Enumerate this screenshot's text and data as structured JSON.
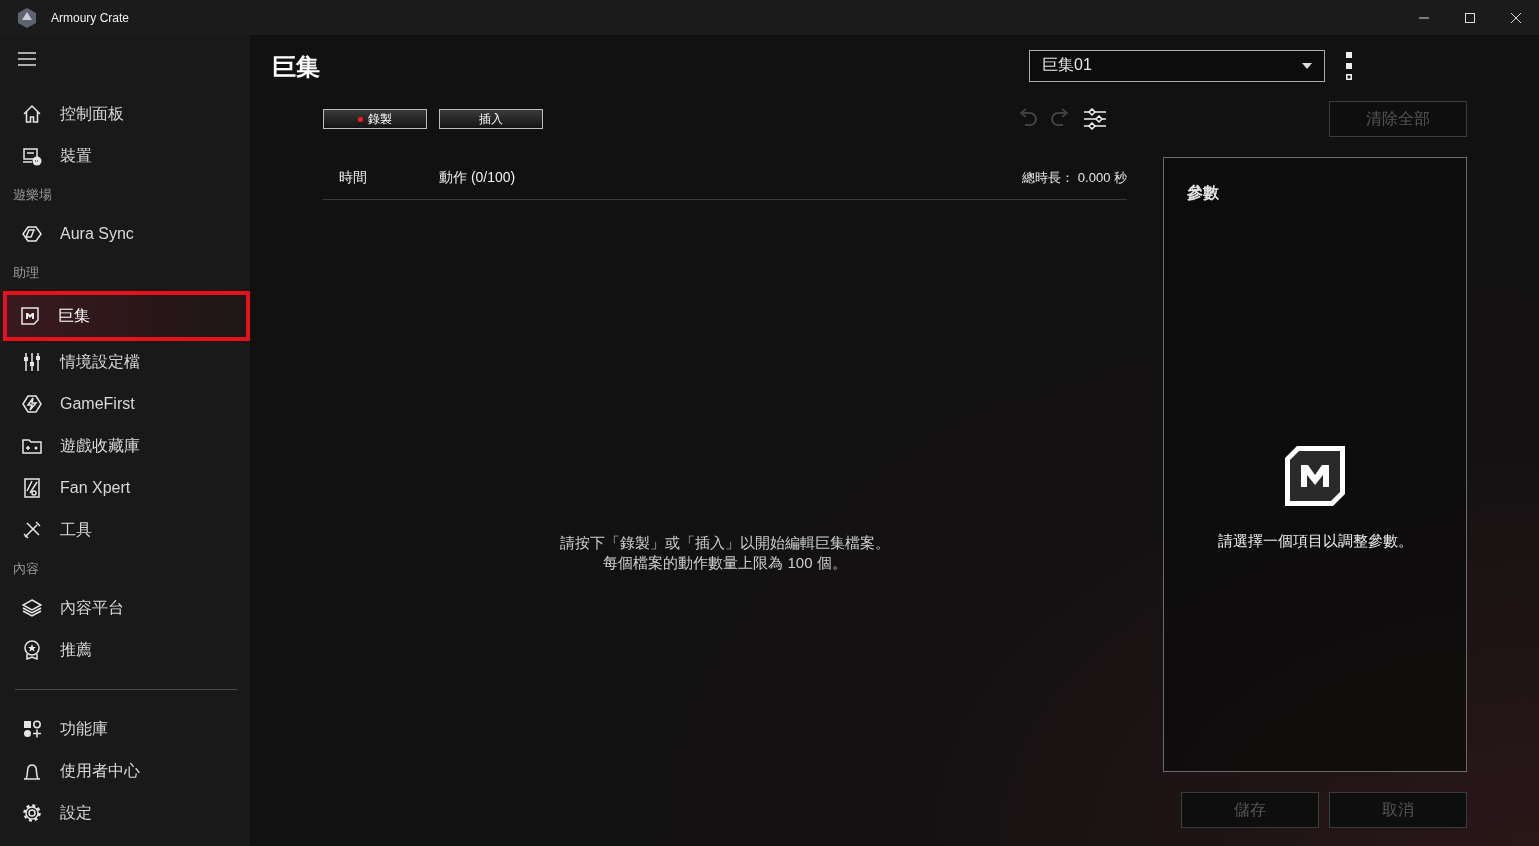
{
  "window": {
    "title": "Armoury Crate"
  },
  "sidebar": {
    "sections": [
      {
        "items": [
          {
            "label": "控制面板",
            "selected": false,
            "highlighted": false
          },
          {
            "label": "裝置",
            "selected": false,
            "highlighted": false
          }
        ]
      },
      {
        "heading": "遊樂場",
        "items": [
          {
            "label": "Aura Sync",
            "selected": false,
            "highlighted": false
          }
        ]
      },
      {
        "heading": "助理",
        "items": [
          {
            "label": "巨集",
            "selected": true,
            "highlighted": true
          },
          {
            "label": "情境設定檔",
            "selected": false,
            "highlighted": false
          },
          {
            "label": "GameFirst",
            "selected": false,
            "highlighted": false
          },
          {
            "label": "遊戲收藏庫",
            "selected": false,
            "highlighted": false
          },
          {
            "label": "Fan Xpert",
            "selected": false,
            "highlighted": false
          },
          {
            "label": "工具",
            "selected": false,
            "highlighted": false
          }
        ]
      },
      {
        "heading": "內容",
        "items": [
          {
            "label": "內容平台",
            "selected": false,
            "highlighted": false
          },
          {
            "label": "推薦",
            "selected": false,
            "highlighted": false
          }
        ]
      }
    ],
    "bottom_items": [
      {
        "label": "功能庫",
        "selected": false,
        "highlighted": false
      },
      {
        "label": "使用者中心",
        "selected": false,
        "highlighted": false
      },
      {
        "label": "設定",
        "selected": false,
        "highlighted": false
      }
    ]
  },
  "main": {
    "title": "巨集",
    "profile": {
      "value": "巨集01"
    },
    "record_button": {
      "label": "錄製"
    },
    "insert_button": {
      "label": "插入"
    },
    "toolbar": [
      {
        "kind": "undo",
        "disabled": true
      },
      {
        "kind": "redo",
        "disabled": true
      },
      {
        "kind": "filter",
        "disabled": false
      }
    ],
    "clear_button": {
      "label": "清除全部",
      "disabled": true
    },
    "table": {
      "columns": [
        "時間",
        "動作 (0/100)"
      ],
      "total": "總時長： 0.000 秒",
      "empty_message": [
        "請按下「錄製」或「插入」以開始編輯巨集檔案。",
        "每個檔案的動作數量上限為 100 個。"
      ]
    },
    "params": {
      "title": "參數",
      "hint": "請選擇一個項目以調整參數。"
    },
    "footer_buttons": [
      {
        "label": "儲存",
        "disabled": true
      },
      {
        "label": "取消",
        "disabled": true
      }
    ]
  }
}
